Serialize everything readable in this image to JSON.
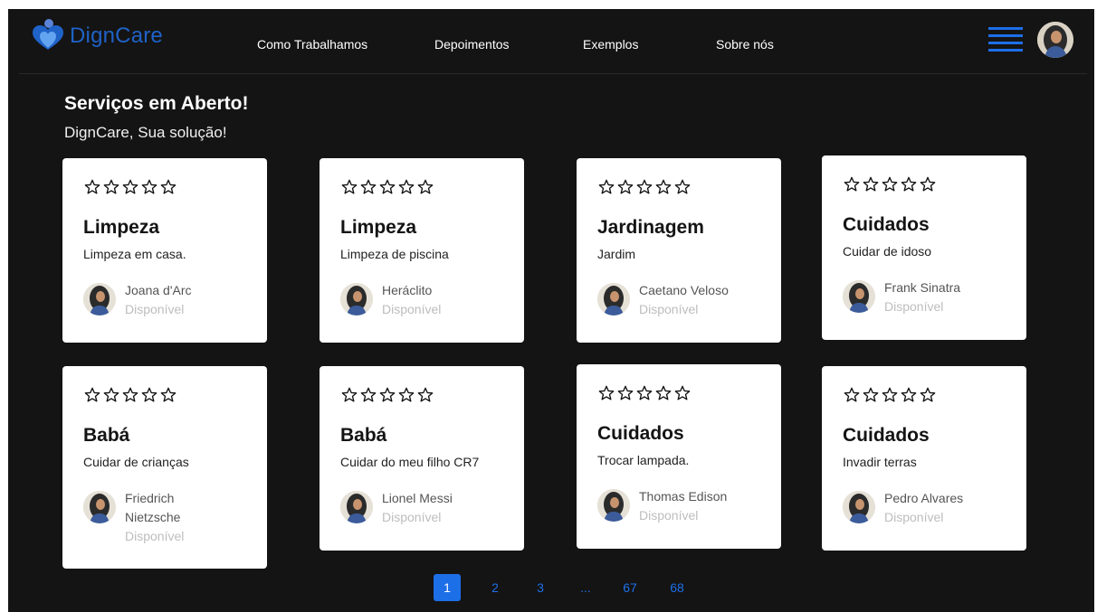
{
  "header": {
    "brand": "DignCare",
    "nav": [
      "Como Trabalhamos",
      "Depoimentos",
      "Exemplos",
      "Sobre nós"
    ]
  },
  "intro": {
    "title": "Serviços em Aberto!",
    "subtitle": "DignCare, Sua solução!"
  },
  "cards": [
    {
      "title": "Limpeza",
      "desc": "Limpeza em casa.",
      "name": "Joana d'Arc",
      "status": "Disponível",
      "rating": 0
    },
    {
      "title": "Limpeza",
      "desc": "Limpeza de piscina",
      "name": "Heráclito",
      "status": "Disponível",
      "rating": 0
    },
    {
      "title": "Jardinagem",
      "desc": "Jardim",
      "name": "Caetano Veloso",
      "status": "Disponível",
      "rating": 0
    },
    {
      "title": "Cuidados",
      "desc": "Cuidar de idoso",
      "name": "Frank Sinatra",
      "status": "Disponível",
      "rating": 0
    },
    {
      "title": "Babá",
      "desc": "Cuidar de crianças",
      "name": "Friedrich Nietzsche",
      "status": "Disponível",
      "rating": 0
    },
    {
      "title": "Babá",
      "desc": "Cuidar do meu filho CR7",
      "name": "Lionel Messi",
      "status": "Disponível",
      "rating": 0
    },
    {
      "title": "Cuidados",
      "desc": "Trocar lampada.",
      "name": "Thomas Edison",
      "status": "Disponível",
      "rating": 0
    },
    {
      "title": "Cuidados",
      "desc": "Invadir terras",
      "name": "Pedro Alvares",
      "status": "Disponível",
      "rating": 0
    }
  ],
  "pagination": {
    "pages": [
      "1",
      "2",
      "3",
      "...",
      "67",
      "68"
    ],
    "current": "1"
  },
  "colors": {
    "background": "#141414",
    "brand": "#1f62c8",
    "accent": "#1d6fe8",
    "card": "#ffffff"
  },
  "icons": {
    "logo": "heart-person-logo-icon",
    "menu": "hamburger-menu-icon",
    "star": "star-outline-icon",
    "avatar": "user-avatar-icon"
  }
}
